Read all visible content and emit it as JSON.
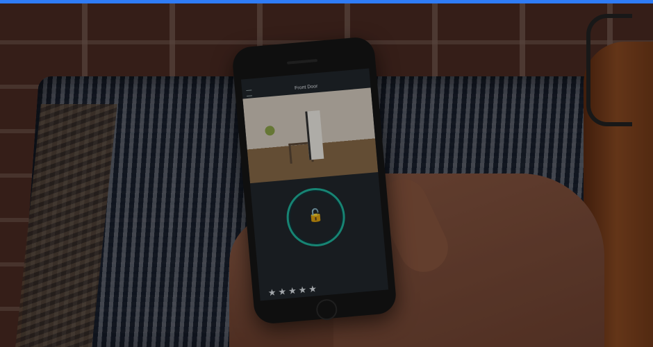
{
  "accent": "#2f7cf6",
  "phone_app": {
    "status_time": "",
    "title": "Front Door",
    "message_line": "",
    "message_link": "",
    "rating_prompt": "",
    "stars": "★★★★★"
  },
  "icons": {
    "menu": "menu-icon",
    "lock": "lock-open-icon",
    "home": "home-button-icon"
  }
}
